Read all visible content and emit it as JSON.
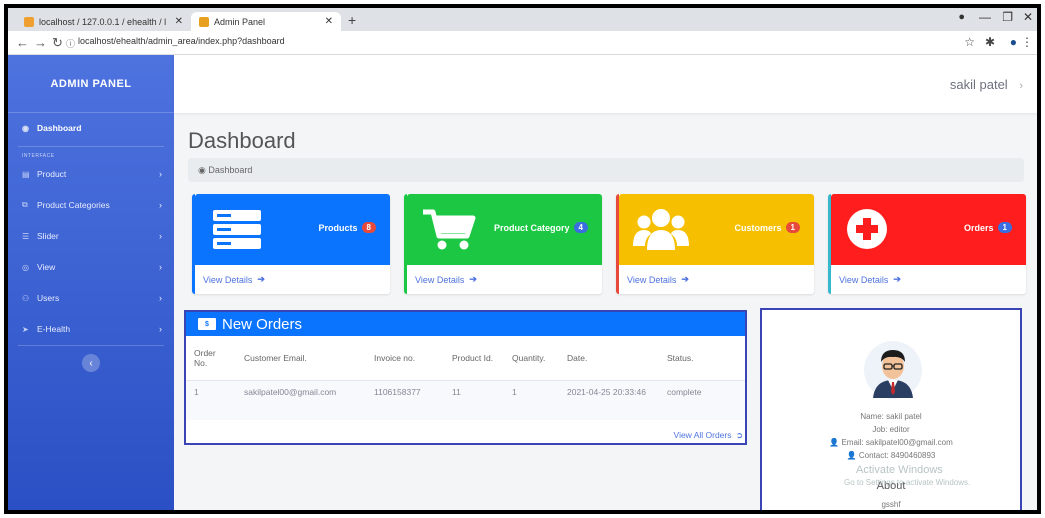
{
  "browser": {
    "tabs": [
      {
        "label": "localhost / 127.0.0.1 / ehealth / l"
      },
      {
        "label": "Admin Panel"
      }
    ],
    "url": "localhost/ehealth/admin_area/index.php?dashboard"
  },
  "sidebar": {
    "brand": "ADMIN PANEL",
    "heading": "INTERFACE",
    "items": [
      {
        "label": "Dashboard",
        "icon": "dashboard-icon"
      },
      {
        "label": "Product",
        "icon": "table-icon"
      },
      {
        "label": "Product Categories",
        "icon": "tag-icon"
      },
      {
        "label": "Slider",
        "icon": "list-icon"
      },
      {
        "label": "View",
        "icon": "eye-icon"
      },
      {
        "label": "Users",
        "icon": "users-icon"
      },
      {
        "label": "E-Health",
        "icon": "send-icon"
      }
    ]
  },
  "topbar": {
    "user": "sakil patel"
  },
  "page": {
    "title": "Dashboard",
    "breadcrumb": "Dashboard"
  },
  "cards": [
    {
      "title": "Products",
      "count": "8",
      "color": "#0b74ff",
      "badge_color": "#e74a3b",
      "link": "View Details"
    },
    {
      "title": "Product Category",
      "count": "4",
      "color": "#1cc843",
      "badge_color": "#3a6ee0",
      "link": "View Details"
    },
    {
      "title": "Customers",
      "count": "1",
      "color": "#f6c000",
      "badge_color": "#e74a3b",
      "link": "View Details"
    },
    {
      "title": "Orders",
      "count": "1",
      "color": "#ff1d1d",
      "badge_color": "#3a6ee0",
      "link": "View Details"
    }
  ],
  "orders": {
    "title": "New Orders",
    "columns": [
      "Order No.",
      "Customer Email.",
      "Invoice no.",
      "Product Id.",
      "Quantity.",
      "Date.",
      "Status."
    ],
    "rows": [
      {
        "order_no": "1",
        "email": "sakilpatel00@gmail.com",
        "invoice": "1106158377",
        "product_id": "11",
        "quantity": "1",
        "date": "2021-04-25 20:33:46",
        "status": "complete"
      }
    ],
    "view_all": "View All Orders"
  },
  "profile": {
    "name": "Name: sakil patel",
    "job": "Job: editor",
    "email": "Email: sakilpatel00@gmail.com",
    "contact": "Contact: 8490460893",
    "about_title": "About",
    "about_text": "gsshf"
  },
  "watermark": {
    "line1": "Activate Windows",
    "line2": "Go to Settings to activate Windows."
  }
}
